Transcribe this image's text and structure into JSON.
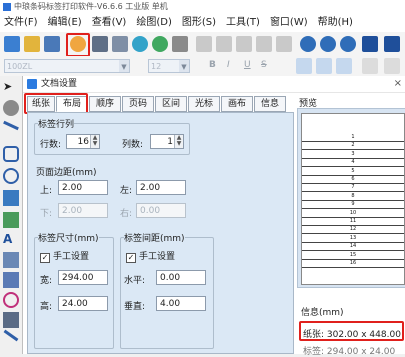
{
  "window": {
    "title": "中琅条码标签打印软件-V6.6.6 工业版 单机"
  },
  "menu": [
    "文件(F)",
    "编辑(E)",
    "查看(V)",
    "绘图(D)",
    "图形(S)",
    "工具(T)",
    "窗口(W)",
    "帮助(H)"
  ],
  "toolbar2": {
    "font_combo": "100ZL",
    "size_combo": "12",
    "style_buttons": [
      "B",
      "I",
      "U",
      "S"
    ]
  },
  "dialog": {
    "title": "文档设置",
    "close": "×",
    "tabs": [
      "纸张",
      "布局",
      "顺序",
      "页码",
      "区间",
      "光标",
      "画布",
      "信息"
    ],
    "active_tab": "布局",
    "rows_cols": {
      "group": "标签行列",
      "rows_label": "行数:",
      "rows_value": "16",
      "cols_label": "列数:",
      "cols_value": "1"
    },
    "margins": {
      "group": "页面边距(mm)",
      "top_label": "上:",
      "top_value": "2.00",
      "left_label": "左:",
      "left_value": "2.00",
      "bottom_label": "下:",
      "bottom_value": "2.00",
      "right_label": "右:",
      "right_value": "0.00"
    },
    "label_size": {
      "group": "标签尺寸(mm)",
      "manual": "手工设置",
      "width_label": "宽:",
      "width_value": "294.00",
      "height_label": "高:",
      "height_value": "24.00"
    },
    "label_spacing": {
      "group": "标签间距(mm)",
      "manual": "手工设置",
      "h_label": "水平:",
      "h_value": "0.00",
      "v_label": "垂直:",
      "v_value": "4.00"
    },
    "preview": {
      "label": "预览",
      "rows": [
        "1",
        "2",
        "3",
        "4",
        "5",
        "6",
        "7",
        "8",
        "9",
        "10",
        "11",
        "12",
        "13",
        "14",
        "15",
        "16"
      ]
    },
    "info": {
      "label": "信息(mm)",
      "paper": "纸张: 302.00 x 448.00",
      "label_size": "标签: 294.00 x 24.00"
    }
  },
  "colors": {
    "highlight": "#e0201c",
    "panel": "#dbe8f5",
    "accent": "#2b7be0"
  }
}
